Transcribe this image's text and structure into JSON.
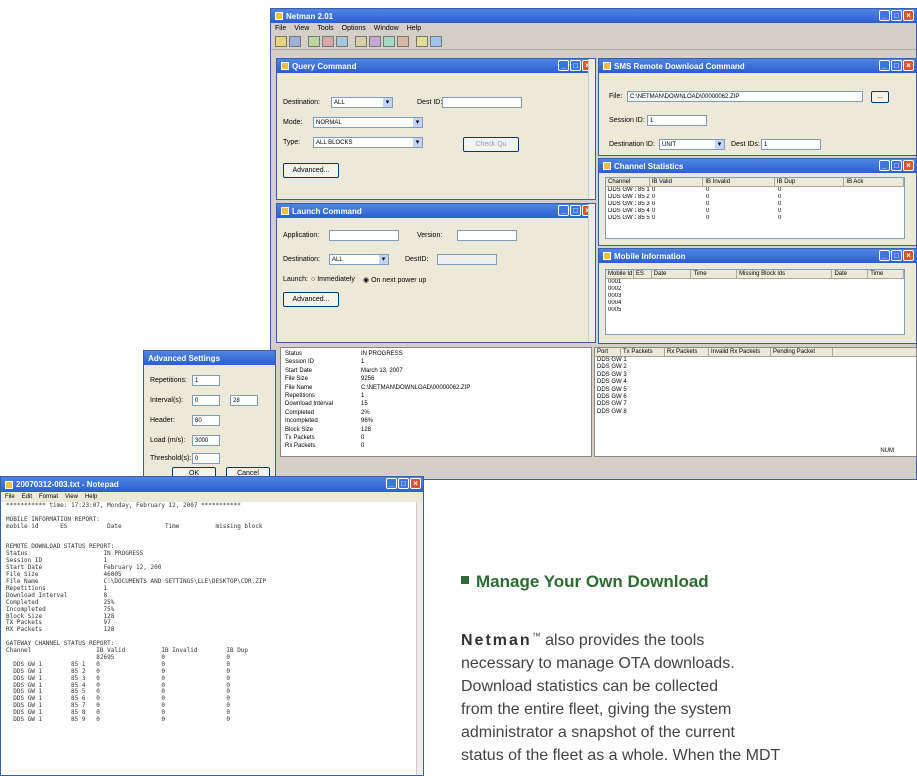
{
  "main_window": {
    "title": "Netman 2.01",
    "menu": [
      "File",
      "View",
      "Tools",
      "Options",
      "Window",
      "Help"
    ],
    "status": "NUM"
  },
  "query_command": {
    "title": "Query Command",
    "destination_label": "Destination:",
    "destination_value": "ALL",
    "dest_id_label": "Dest ID:",
    "mode_label": "Mode:",
    "mode_value": "NORMAL",
    "type_label": "Type:",
    "type_value": "ALL BLOCKS",
    "check_label": "Check Qu",
    "advanced_label": "Advanced..."
  },
  "launch_command": {
    "title": "Launch Command",
    "application_label": "Application:",
    "version_label": "Version:",
    "destination_label": "Destination:",
    "destination_value": "ALL",
    "dest_id_label": "DestID:",
    "launch_label": "Launch:",
    "immediately": "Immediately",
    "on_power_up": "On next power up",
    "advanced_label": "Advanced..."
  },
  "remote_download": {
    "title": "SMS Remote Download Command",
    "file_label": "File:",
    "file_value": "C:\\NETMAN\\DOWNLOAD\\00000062.ZIP",
    "session_label": "Session ID:",
    "session_value": "1",
    "destination_label": "Destination ID:",
    "destination_value": "UNIT",
    "dest_ids_label": "Dest IDs:",
    "dest_ids_value": "1"
  },
  "channel_statistics": {
    "title": "Channel Statistics",
    "columns": [
      "Channel",
      "IB Valid",
      "IB Invalid",
      "IB Dup",
      "IB Ack"
    ],
    "rows": [
      [
        "DDS GW 1",
        "85 1",
        "0",
        "0",
        "0"
      ],
      [
        "DDS GW 1",
        "85 2",
        "0",
        "0",
        "0"
      ],
      [
        "DDS GW 1",
        "85 3",
        "0",
        "0",
        "0"
      ],
      [
        "DDS GW 1",
        "85 4",
        "0",
        "0",
        "0"
      ],
      [
        "DDS GW 1",
        "85 5",
        "0",
        "0",
        "0"
      ]
    ]
  },
  "mobile_information": {
    "title": "Mobile Information",
    "columns": [
      "Mobile Id",
      "ES",
      "Date",
      "Time",
      "Missing Block lds",
      "Date",
      "Time"
    ],
    "rows": [
      "0001",
      "0002",
      "0003",
      "0004",
      "0005"
    ]
  },
  "status_panel": {
    "labels": [
      "Status",
      "Session ID",
      "Start Date",
      "File Size",
      "File Name",
      "Repetitions",
      "Download Interval",
      "Completed",
      "Incompleted",
      "Block Size",
      "Tx Packets",
      "Rx Packets"
    ],
    "values": [
      "IN PROGRESS",
      "1",
      "March 13, 2007",
      "9256",
      "C:\\NETMAN\\DOWNLOAD\\00000062.ZIP",
      "1",
      "15",
      "2%",
      "96%",
      "128",
      "0",
      "0"
    ]
  },
  "port_panel": {
    "columns": [
      "Port",
      "Tx Packets",
      "Rx Packets",
      "Invalid Rx Packets",
      "Pending Packet"
    ],
    "rows": [
      "DDS GW 1",
      "DDS GW 2",
      "DDS GW 3",
      "DDS GW 4",
      "DDS GW 5",
      "DDS GW 6",
      "DDS GW 7",
      "DDS GW 8"
    ]
  },
  "advanced_settings": {
    "title": "Advanced Settings",
    "repetitions_label": "Repetitions:",
    "repetitions_value": "1",
    "interval_label": "Interval(s):",
    "interval_value": "0",
    "interval_value2": "28",
    "header_label": "Header:",
    "header_value": "80",
    "load_label": "Load (m/s):",
    "load_value": "3000",
    "threshold_label": "Threshold(s):",
    "threshold_value": "0",
    "ok_label": "OK",
    "cancel_label": "Cancel"
  },
  "notepad": {
    "title": "20070312-003.txt - Notepad",
    "menu": [
      "File",
      "Edit",
      "Format",
      "View",
      "Help"
    ],
    "content": "*********** time: 17:23:07, Monday, February 12, 2007 ***********\n\nMOBILE INFORMATION REPORT:\nmobile id      ES           Date            Time          missing block\n\n\nREMOTE DOWNLOAD STATUS REPORT:\nStatus                     IN PROGRESS\nSession ID                 1\nStart Date                 February 12, 200\nFile Size                  46005\nFile Name                  C:\\DOCUMENTS AND SETTINGS\\LLE\\DESKTOP\\CDR.ZIP\nRepetitions                1\nDownload Interval          8\nCompleted                  25%\nIncompleted                75%\nBlock Size                 128\nTX Packets                 97\nRX Packets                 128\n\nGATEWAY CHANNEL STATUS REPORT:\nChannel                  IB Valid          IB Invalid        IB Dup\n                         82695             0                 0\n  DDS GW 1        85 1   0                 0                 0\n  DDS GW 1        85 2   0                 0                 0\n  DDS GW 1        85 3   0                 0                 0\n  DDS GW 1        85 4   0                 0                 0\n  DDS GW 1        85 5   0                 0                 0\n  DDS GW 1        85 6   0                 0                 0\n  DDS GW 1        85 7   0                 0                 0\n  DDS GW 1        85 8   0                 0                 0\n  DDS GW 1        85 9   0                 0                 0"
  },
  "promo": {
    "heading": "Manage Your Own Download",
    "brand": "Netman",
    "tm": "™",
    "line1_rest": " also provides the tools",
    "line2": "necessary to manage OTA downloads.",
    "line3": "Download statistics can be collected",
    "line4": "from the entire fleet, giving the system",
    "line5": "administrator a snapshot of the current",
    "line6": "status of the fleet as a whole. When the MDT"
  }
}
